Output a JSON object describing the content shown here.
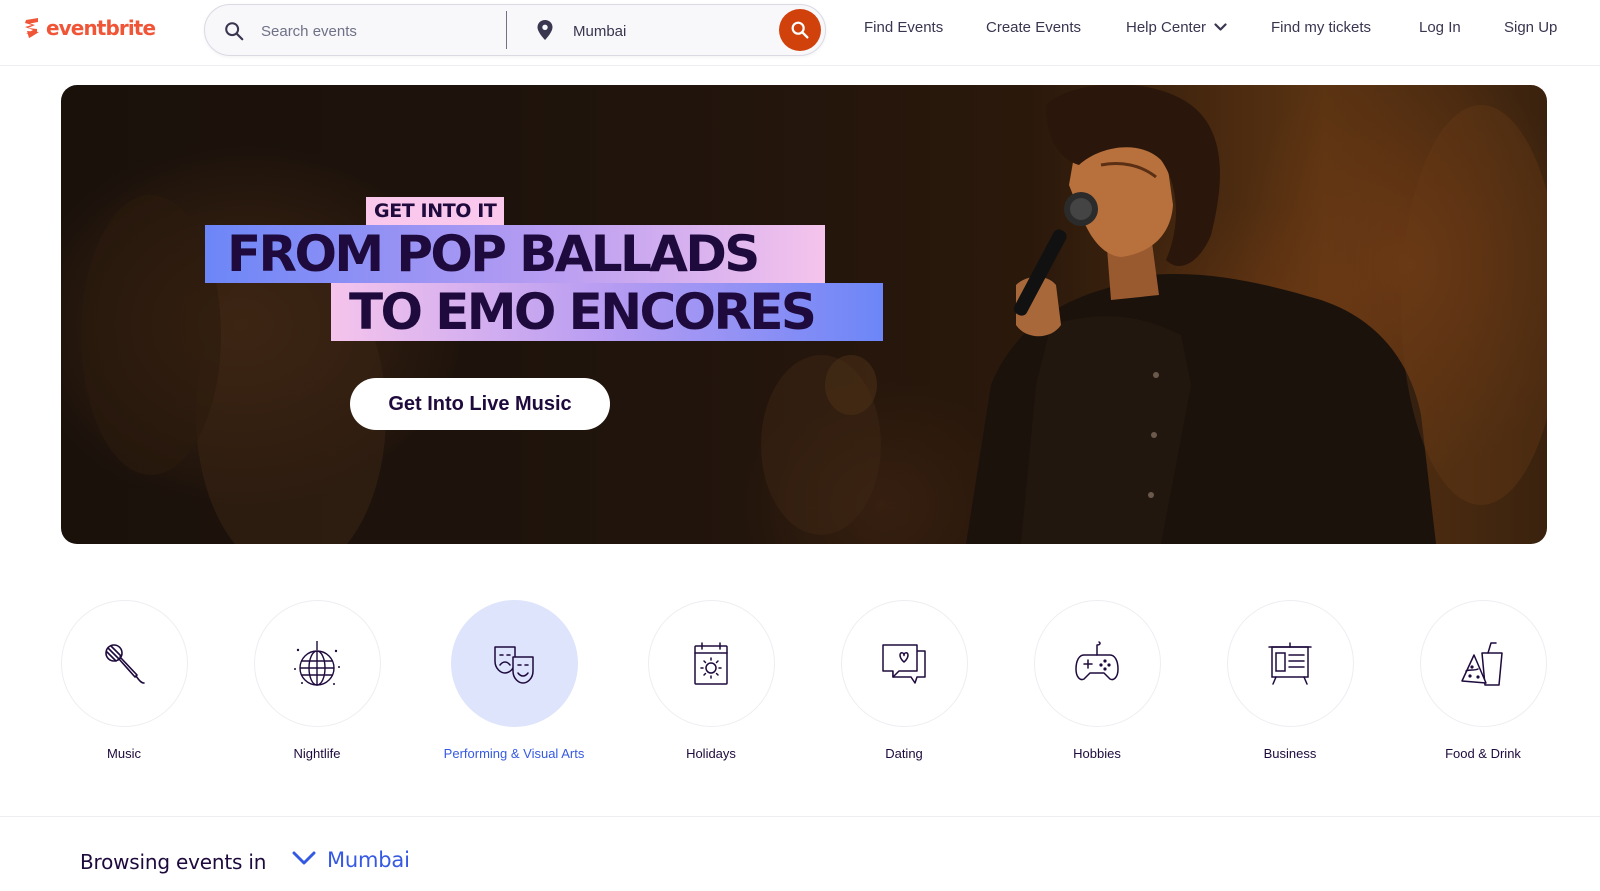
{
  "header": {
    "logo_text": "eventbrite",
    "search": {
      "placeholder": "Search events",
      "location_value": "Mumbai"
    },
    "nav": {
      "find_events": "Find Events",
      "create_events": "Create Events",
      "help_center": "Help Center",
      "find_tickets": "Find my tickets",
      "log_in": "Log In",
      "sign_up": "Sign Up"
    }
  },
  "hero": {
    "tag": "GET INTO IT",
    "headline_line1": "FROM POP BALLADS",
    "headline_line2": "TO EMO ENCORES",
    "cta_label": "Get Into Live Music"
  },
  "categories": [
    {
      "label": "Music",
      "icon": "microphone-icon",
      "active": false
    },
    {
      "label": "Nightlife",
      "icon": "disco-ball-icon",
      "active": false
    },
    {
      "label": "Performing & Visual Arts",
      "icon": "theater-masks-icon",
      "active": true
    },
    {
      "label": "Holidays",
      "icon": "calendar-sun-icon",
      "active": false
    },
    {
      "label": "Dating",
      "icon": "chat-heart-icon",
      "active": false
    },
    {
      "label": "Hobbies",
      "icon": "gamepad-icon",
      "active": false
    },
    {
      "label": "Business",
      "icon": "presentation-board-icon",
      "active": false
    },
    {
      "label": "Food & Drink",
      "icon": "food-drink-icon",
      "active": false
    }
  ],
  "browsing": {
    "label": "Browsing events in",
    "location": "Mumbai"
  },
  "colors": {
    "brand": "#f05537",
    "search_button": "#d1410c",
    "text_primary": "#1e0a3c",
    "link_blue": "#3659e3",
    "active_category_bg": "#dde4fb",
    "tag_pink": "#f9c8ec",
    "headline_blue": "#6c86f7"
  }
}
